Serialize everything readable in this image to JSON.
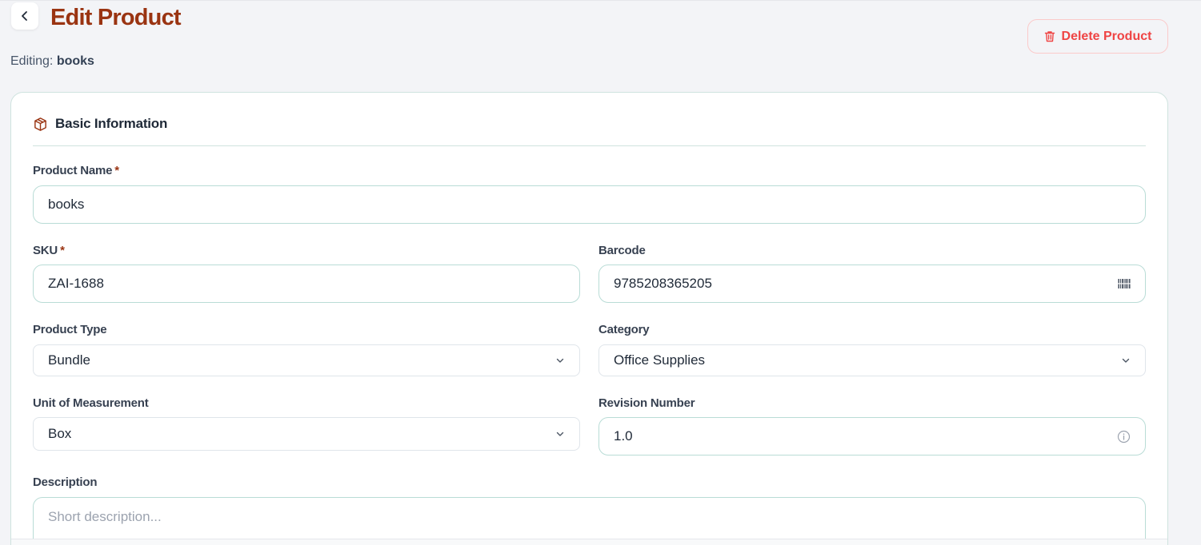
{
  "header": {
    "title": "Edit Product",
    "editing_prefix": "Editing:",
    "editing_name": "books",
    "delete_label": "Delete Product"
  },
  "section": {
    "title": "Basic Information"
  },
  "fields": {
    "product_name": {
      "label": "Product Name",
      "required": "*",
      "value": "books"
    },
    "sku": {
      "label": "SKU",
      "required": "*",
      "value": "ZAI-1688"
    },
    "barcode": {
      "label": "Barcode",
      "value": "9785208365205"
    },
    "product_type": {
      "label": "Product Type",
      "value": "Bundle"
    },
    "category": {
      "label": "Category",
      "value": "Office Supplies"
    },
    "unit": {
      "label": "Unit of Measurement",
      "value": "Box"
    },
    "revision": {
      "label": "Revision Number",
      "value": "1.0"
    },
    "description": {
      "label": "Description",
      "placeholder": "Short description..."
    }
  },
  "icons": {
    "back": "chevron-left-icon",
    "delete": "trash-icon",
    "section": "package-icon",
    "barcode": "barcode-icon",
    "select": "chevron-down-icon",
    "info": "info-icon"
  },
  "colors": {
    "title": "#9a3412",
    "danger": "#ef4444",
    "field_border": "#b9dcd6",
    "background": "#f3f4f7"
  }
}
